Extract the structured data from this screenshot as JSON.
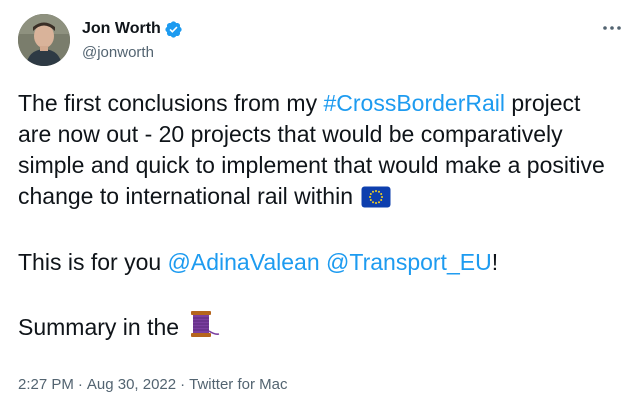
{
  "author": {
    "name": "Jon Worth",
    "handle": "@jonworth",
    "verified_icon": "verified-badge-icon",
    "avatar": "avatar"
  },
  "menu": {
    "icon": "more-dots-icon"
  },
  "tweet": {
    "line1_prefix": "The first conclusions from my ",
    "hashtag": "#CrossBorderRail",
    "line1_rest": " project are now out - 20 projects that would be comparatively simple and quick to implement that would make a positive change to international rail within ",
    "flag_emoji": "eu-flag-icon",
    "line2_prefix": "This is for you ",
    "mention1": "@AdinaValean",
    "mention_sep": " ",
    "mention2": "@Transport_EU",
    "line2_suffix": "!",
    "line3_prefix": "Summary in the ",
    "thread_emoji": "thread-spool-icon"
  },
  "meta": {
    "time": "2:27 PM",
    "sep1": "·",
    "date": "Aug 30, 2022",
    "sep2": "·",
    "source": "Twitter for Mac"
  },
  "colors": {
    "link": "#1d9bf0",
    "text": "#0f1419",
    "secondary": "#536471"
  }
}
